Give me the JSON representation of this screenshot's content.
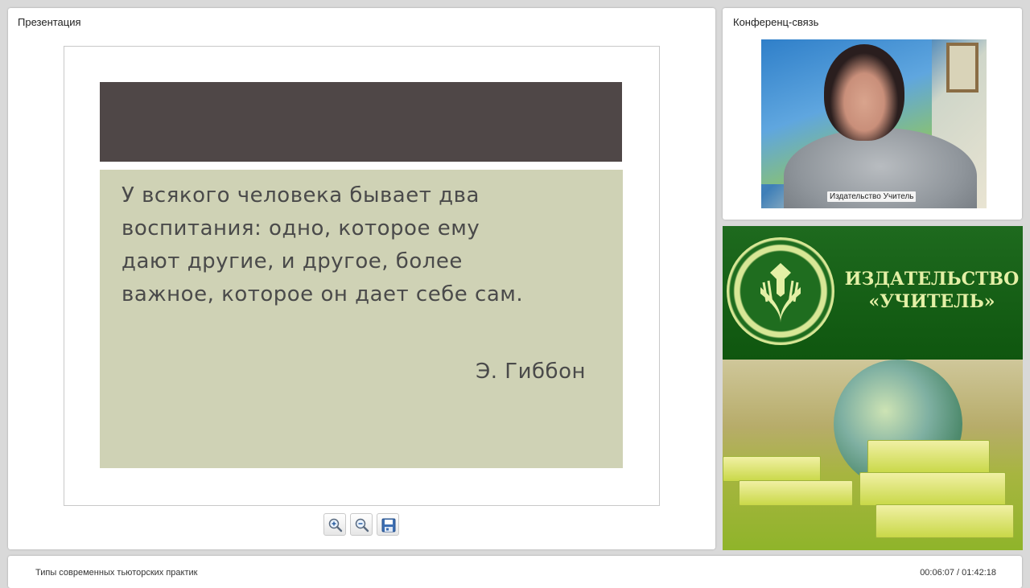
{
  "presentation": {
    "title": "Презентация",
    "slide": {
      "quote_lines": [
        "У всякого человека бывает два",
        "воспитания: одно, которое ему",
        "дают другие, и другое, более",
        "важное, которое он дает себе сам."
      ],
      "author": "Э. Гиббон",
      "band_color": "#4f4747",
      "body_color": "#cfd2b5"
    },
    "toolbar": {
      "zoom_in_icon": "zoom-in-icon",
      "zoom_out_icon": "zoom-out-icon",
      "save_icon": "floppy-disk-icon"
    }
  },
  "conference": {
    "title": "Конференц-связь",
    "camera_label": "Издательство Учитель"
  },
  "brand": {
    "name_line1": "ИЗДАТЕЛЬСТВО",
    "name_line2": "«УЧИТЕЛЬ»",
    "color": "#1e6a1e",
    "text_color": "#e4f0a6"
  },
  "footer": {
    "title": "Типы современных тьюторских практик",
    "time": "00:06:07 / 01:42:18"
  }
}
